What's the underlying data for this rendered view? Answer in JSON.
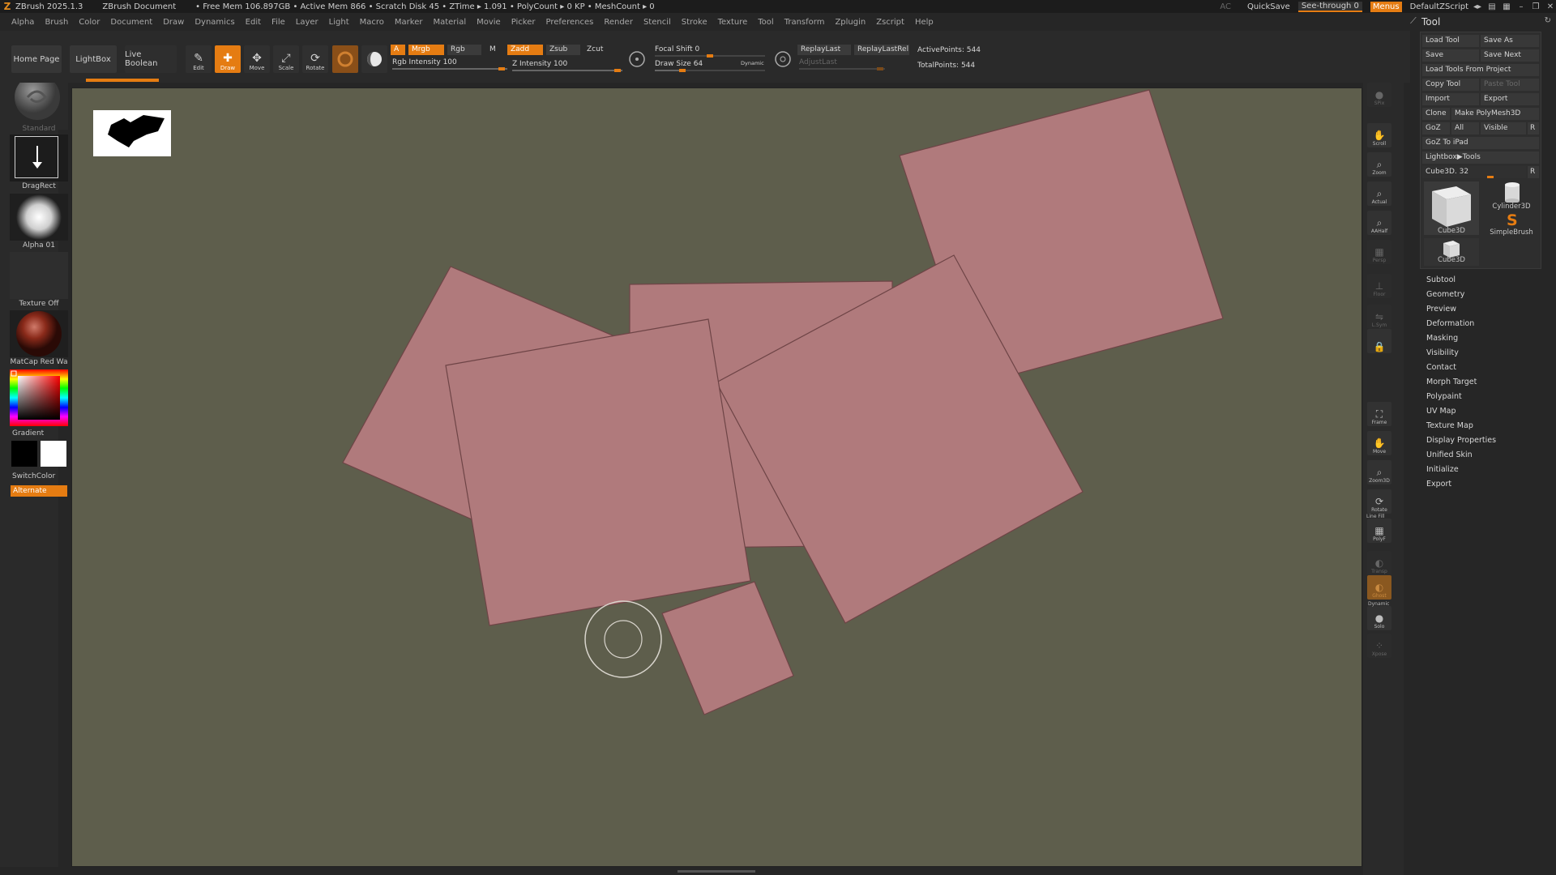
{
  "titlebar": {
    "app": "ZBrush 2025.1.3",
    "document": "ZBrush Document",
    "stats": "• Free Mem 106.897GB • Active Mem 866 • Scratch Disk 45 • ZTime ▸ 1.091 • PolyCount ▸ 0 KP • MeshCount ▸ 0",
    "ac": "AC",
    "quicksave": "QuickSave",
    "seethrough": "See-through  0",
    "menus": "Menus",
    "defaultzscript": "DefaultZScript"
  },
  "menubar": [
    "Alpha",
    "Brush",
    "Color",
    "Document",
    "Draw",
    "Dynamics",
    "Edit",
    "File",
    "Layer",
    "Light",
    "Macro",
    "Marker",
    "Material",
    "Movie",
    "Picker",
    "Preferences",
    "Render",
    "Stencil",
    "Stroke",
    "Texture",
    "Tool",
    "Transform",
    "Zplugin",
    "Zscript",
    "Help"
  ],
  "toolbar": {
    "home_page": "Home Page",
    "lightbox": "LightBox",
    "live_boolean": "Live Boolean",
    "edit": "Edit",
    "draw": "Draw",
    "move": "Move",
    "scale": "Scale",
    "rotate": "Rotate",
    "a": "A",
    "mrgb": "Mrgb",
    "rgb": "Rgb",
    "m": "M",
    "rgb_intensity": "Rgb Intensity 100",
    "zadd": "Zadd",
    "zsub": "Zsub",
    "zcut": "Zcut",
    "z_intensity": "Z Intensity 100",
    "focal_shift": "Focal Shift 0",
    "draw_size": "Draw Size 64",
    "dynamic": "Dynamic",
    "replay_last": "ReplayLast",
    "replay_last_rel": "ReplayLastRel",
    "adjust_last": "AdjustLast",
    "active_points": "ActivePoints: 544",
    "total_points": "TotalPoints: 544",
    "rgb_intensity_value": 100,
    "z_intensity_value": 100,
    "focal_shift_value": 0,
    "draw_size_value": 64
  },
  "leftshelf": {
    "brush": "Standard",
    "stroke": "DragRect",
    "alpha": "Alpha 01",
    "texture": "Texture Off",
    "material": "MatCap Red Wa",
    "gradient": "Gradient",
    "switchcolor": "SwitchColor",
    "alternate": "Alternate"
  },
  "rightshelf": [
    {
      "name": "spix-button",
      "label": "SPix",
      "dim": true
    },
    {
      "name": "scroll-button",
      "label": "Scroll",
      "dim": false
    },
    {
      "name": "zoom-button",
      "label": "Zoom",
      "dim": false
    },
    {
      "name": "actual-button",
      "label": "Actual",
      "dim": false
    },
    {
      "name": "aahalf-button",
      "label": "AAHalf",
      "dim": false
    },
    {
      "name": "persp-button",
      "label": "Persp",
      "dim": true
    },
    {
      "name": "floor-button",
      "label": "Floor",
      "dim": true
    },
    {
      "name": "lsym-button",
      "label": "L.Sym",
      "dim": true
    },
    {
      "name": "lock-button",
      "label": "",
      "dim": false
    },
    {
      "name": "frame-button",
      "label": "Frame",
      "dim": false
    },
    {
      "name": "move-view-button",
      "label": "Move",
      "dim": false
    },
    {
      "name": "zoom3d-button",
      "label": "Zoom3D",
      "dim": false
    },
    {
      "name": "rotate-view-button",
      "label": "Rotate",
      "dim": false
    },
    {
      "name": "polyf-button",
      "label": "PolyF",
      "dim": false
    },
    {
      "name": "transp-button",
      "label": "Transp",
      "dim": true
    },
    {
      "name": "ghost-button",
      "label": "Ghost",
      "dim": false
    },
    {
      "name": "solo-button",
      "label": "Solo",
      "dim": false
    },
    {
      "name": "xpose-button",
      "label": "Xpose",
      "dim": true
    }
  ],
  "rightshelf_extra": {
    "linefill": "Line Fill",
    "dynamic": "Dynamic"
  },
  "toolpanel": {
    "title": "Tool",
    "load_tool": "Load Tool",
    "save_as": "Save As",
    "save": "Save",
    "save_next": "Save Next",
    "load_tools_from_project": "Load Tools From Project",
    "copy_tool": "Copy Tool",
    "paste_tool": "Paste Tool",
    "import": "Import",
    "export": "Export",
    "clone": "Clone",
    "make_polymesh3d": "Make PolyMesh3D",
    "goz": "GoZ",
    "all": "All",
    "visible": "Visible",
    "r": "R",
    "goz_to_ipad": "GoZ To iPad",
    "lightbox_tools": "Lightbox▶Tools",
    "cube3d_slider": "Cube3D. 32",
    "thumb_cube3d": "Cube3D",
    "thumb_cylinder3d": "Cylinder3D",
    "thumb_simplebrush": "SimpleBrush",
    "thumb_cube3d_small": "Cube3D",
    "sections": [
      "Subtool",
      "Geometry",
      "Preview",
      "Deformation",
      "Masking",
      "Visibility",
      "Contact",
      "Morph Target",
      "Polypaint",
      "UV Map",
      "Texture Map",
      "Display Properties",
      "Unified Skin",
      "Initialize",
      "Export"
    ]
  },
  "colors": {
    "accent": "#e57c12",
    "canvas": "#5e5e4c",
    "shape_fill": "#b07a7c",
    "shape_edge": "#6e4446"
  }
}
